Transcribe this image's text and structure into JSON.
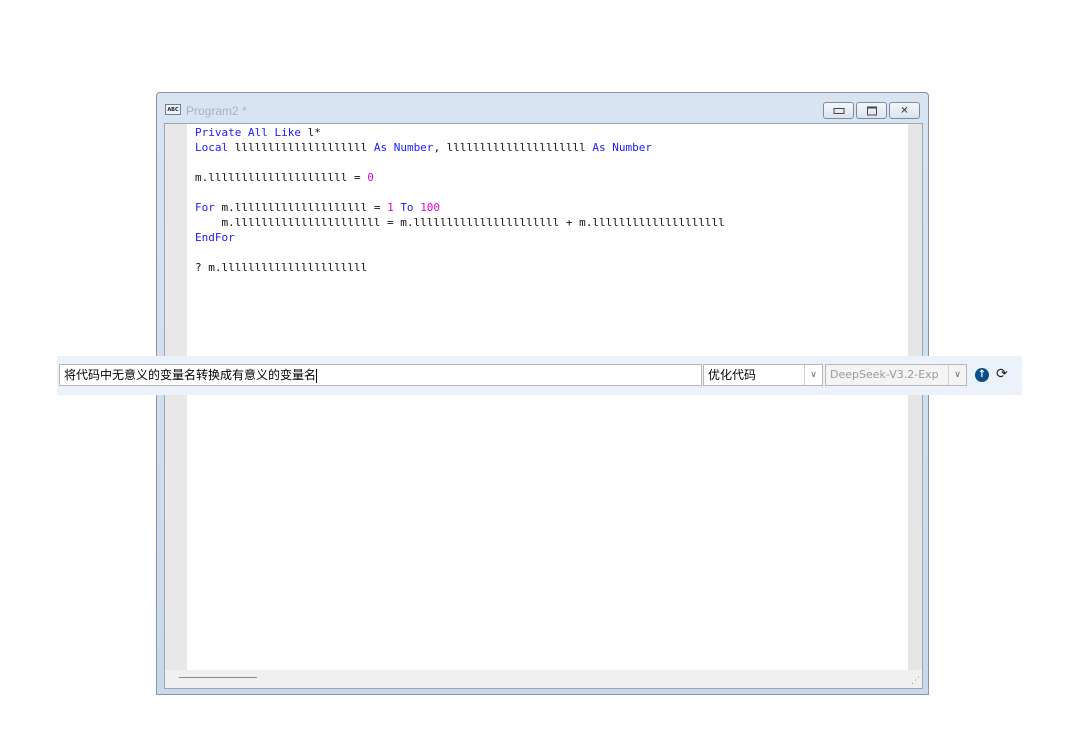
{
  "window": {
    "title": "Program2 *",
    "icon": "abc-document-icon",
    "buttons": {
      "minimize": "minimize-icon",
      "maximize": "maximize-icon",
      "close": "close-icon"
    }
  },
  "code": {
    "line1": {
      "kw": "Private All Like",
      "rest": " l*"
    },
    "line2": {
      "kw1": "Local",
      "a": " llllllllllllllllllll ",
      "kw2": "As Number",
      "b": ", lllllllllllllllllllll ",
      "kw3": "As Number"
    },
    "line4": "m.lllllllllllllllllllll = ",
    "line4_num": "0",
    "line6": {
      "kw1": "For",
      "a": " m.llllllllllllllllllll = ",
      "n1": "1",
      "kw2": "To",
      "n2": "100"
    },
    "line7": "    m.llllllllllllllllllllll = m.llllllllllllllllllllll + m.llllllllllllllllllll",
    "line8": "EndFor",
    "line10": "? m.llllllllllllllllllllll"
  },
  "prompt": {
    "input_value": "将代码中无意义的变量名转换成有意义的变量名",
    "action_select": "优化代码",
    "model_select": "DeepSeek-V3.2-Exp",
    "send_icon": "arrow-up-circle-icon",
    "reset_icon": "refresh-icon"
  }
}
